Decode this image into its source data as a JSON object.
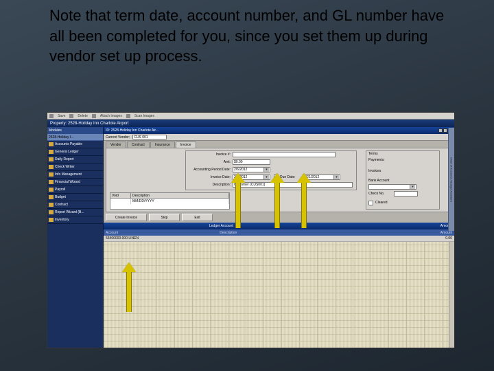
{
  "note": "Note that term date, account number, and GL number have all been completed for you, since you set them up during vendor set up process.",
  "toolbar": {
    "save": "Save",
    "delete": "Delete",
    "attach": "Attach Images",
    "scan": "Scan Images"
  },
  "title_property": "Property: 2528-Holiday Inn Charlote Airport",
  "sidebar": {
    "header": "Modules",
    "tab": "2528-Holiday I...",
    "items": [
      "Accounts Payable",
      "General Ledger",
      "Daily Report",
      "Check Writer",
      "Info Management",
      "Financial Wizard",
      "Payroll",
      "Budget",
      "Contract",
      "Report Wizard (B...",
      "Inventory"
    ]
  },
  "right_stub": "Chart of Accounts / Budget Assistant",
  "window": {
    "id": "ID: 2528-Holiday Inn Charlote Air...",
    "close": "×"
  },
  "vendor_bar": {
    "label": "Current Vendor:",
    "value": "CUS 001"
  },
  "tabs": [
    "Vendor",
    "Contract",
    "Insurance",
    "Invoice"
  ],
  "form": {
    "invoice_no_label": "Invoice #:",
    "invoice_no": "",
    "amt_label": "Amt:",
    "amt": "$0.00",
    "acct_period_label": "Accounting Period Date:",
    "acct_period": "2/6/2012",
    "invoice_date_label": "Invoice Date:",
    "invoice_date": "2/6/2012",
    "due_date_label": "Due Date:",
    "due_date": "2/21/2012",
    "desc_label": "Description:",
    "desc": "Customer (CUS001)",
    "terms_label": "Terms",
    "payments_label": "Payments:",
    "invoices_label": "Invoices",
    "bank_label": "Bank Account",
    "check_no_label": "Check No.",
    "check_no": "",
    "cleared_label": "Cleared",
    "void_col1": "Void",
    "void_col2": "Description",
    "void_date": "MM/DD/YYYY"
  },
  "buttons": {
    "create": "Create Invoice",
    "skip": "Skip",
    "exit": "Exit"
  },
  "grid": {
    "header": "Ledger Account",
    "header_right": "Amount",
    "sub_left": "Account",
    "sub_mid": "Description",
    "sub_right": "Amount",
    "row_account": "53400000.000 LINEN",
    "row_amount": "0.00"
  }
}
